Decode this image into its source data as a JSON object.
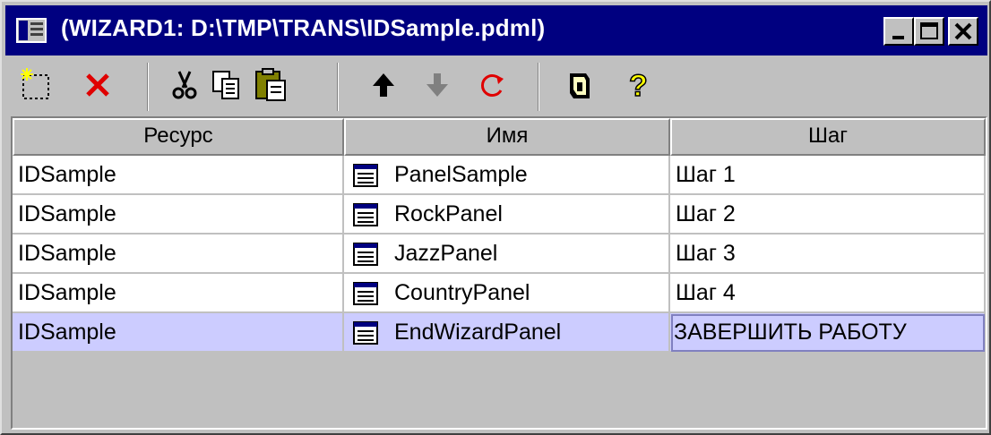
{
  "window": {
    "title": "(WIZARD1: D:\\TMP\\TRANS\\IDSample.pdml)",
    "colors": {
      "titlebar": "#000080",
      "selected_row": "#ccccff",
      "face": "#c0c0c0"
    }
  },
  "toolbar": {
    "buttons": [
      {
        "name": "new-button",
        "icon": "new-icon"
      },
      {
        "name": "delete-button",
        "icon": "red-x-icon"
      },
      {
        "name": "cut-button",
        "icon": "scissors-icon"
      },
      {
        "name": "copy-button",
        "icon": "copy-icon"
      },
      {
        "name": "paste-button",
        "icon": "paste-icon"
      },
      {
        "name": "move-up-button",
        "icon": "arrow-up-icon"
      },
      {
        "name": "move-down-button",
        "icon": "arrow-down-icon"
      },
      {
        "name": "refresh-button",
        "icon": "refresh-icon"
      },
      {
        "name": "properties-button",
        "icon": "properties-icon"
      },
      {
        "name": "help-button",
        "icon": "question-icon"
      }
    ]
  },
  "table": {
    "columns": [
      "Ресурс",
      "Имя",
      "Шаг"
    ],
    "rows": [
      {
        "resource": "IDSample",
        "name": "PanelSample",
        "step": "Шаг 1"
      },
      {
        "resource": "IDSample",
        "name": "RockPanel",
        "step": "Шаг 2"
      },
      {
        "resource": "IDSample",
        "name": "JazzPanel",
        "step": "Шаг 3"
      },
      {
        "resource": "IDSample",
        "name": "CountryPanel",
        "step": "Шаг 4"
      },
      {
        "resource": "IDSample",
        "name": "EndWizardPanel",
        "step": "ЗАВЕРШИТЬ РАБОТУ",
        "selected": true
      }
    ]
  }
}
